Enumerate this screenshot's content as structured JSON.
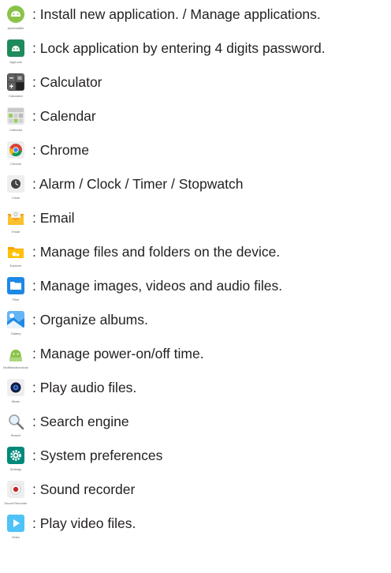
{
  "apps": [
    {
      "icon_caption": "ApkInstaller",
      "icon": "android-head-icon",
      "description": ": Install new application. / Manage applications."
    },
    {
      "icon_caption": "AppLock",
      "icon": "android-lock-icon",
      "description": ": Lock application by entering 4 digits password."
    },
    {
      "icon_caption": "Calculator",
      "icon": "calculator-icon",
      "description": ": Calculator"
    },
    {
      "icon_caption": "Calendar",
      "icon": "calendar-icon",
      "description": ": Calendar"
    },
    {
      "icon_caption": "Chrome",
      "icon": "chrome-icon",
      "description": ": Chrome"
    },
    {
      "icon_caption": "Clock",
      "icon": "clock-icon",
      "description": ": Alarm / Clock / Timer / Stopwatch"
    },
    {
      "icon_caption": "Email",
      "icon": "email-icon",
      "description": ": Email"
    },
    {
      "icon_caption": "Explorer",
      "icon": "folder-explorer-icon",
      "description": ": Manage files and folders on the device."
    },
    {
      "icon_caption": "Files",
      "icon": "files-icon",
      "description": ": Manage images, videos and audio files."
    },
    {
      "icon_caption": "Gallery",
      "icon": "gallery-icon",
      "description": ": Organize albums."
    },
    {
      "icon_caption": "Multifunctionclock",
      "icon": "android-power-icon",
      "description": ": Manage power-on/off time."
    },
    {
      "icon_caption": "Music",
      "icon": "music-icon",
      "description": ": Play audio files."
    },
    {
      "icon_caption": "Search",
      "icon": "search-icon",
      "description": ": Search engine"
    },
    {
      "icon_caption": "Settings",
      "icon": "settings-gear-icon",
      "description": ": System preferences"
    },
    {
      "icon_caption": "Sound Recorder",
      "icon": "sound-recorder-icon",
      "description": ": Sound recorder"
    },
    {
      "icon_caption": "Video",
      "icon": "video-play-icon",
      "description": ": Play video files."
    }
  ]
}
